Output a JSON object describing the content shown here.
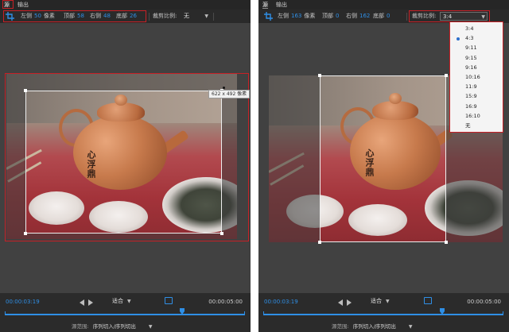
{
  "tabs": {
    "source": "源",
    "output": "输出"
  },
  "left_panel": {
    "fields": {
      "left_label": "左侧",
      "left_value": "50",
      "unit": "像素",
      "top_label": "顶部",
      "top_value": "58",
      "right_label": "右侧",
      "right_value": "48",
      "bottom_label": "底部",
      "bottom_value": "26"
    },
    "ratio_label": "裁剪比例:",
    "ratio_value": "无",
    "size_tooltip": "622 x 492 像素"
  },
  "right_panel": {
    "fields": {
      "left_label": "左侧",
      "left_value": "163",
      "unit": "像素",
      "top_label": "顶部",
      "top_value": "0",
      "right_label": "右侧",
      "right_value": "162",
      "bottom_label": "底部",
      "bottom_value": "0"
    },
    "ratio_label": "裁剪比例:",
    "ratio_value": "3:4",
    "ratio_options": [
      "3:4",
      "4:3",
      "9:11",
      "9:15",
      "9:16",
      "10:16",
      "11:9",
      "15:9",
      "16:9",
      "16:10",
      "无"
    ],
    "selected_option": "4:3"
  },
  "image": {
    "calligraphy": "心浮鼎"
  },
  "controls": {
    "current_time": "00:00:03:19",
    "duration": "00:00:05:00",
    "fit_label": "适合",
    "range_label": "源范围:",
    "range_value": "序列切入/序列切出",
    "playhead_fraction": 0.755
  },
  "colors": {
    "accent": "#2f8fe6",
    "highlight": "#c72026"
  }
}
